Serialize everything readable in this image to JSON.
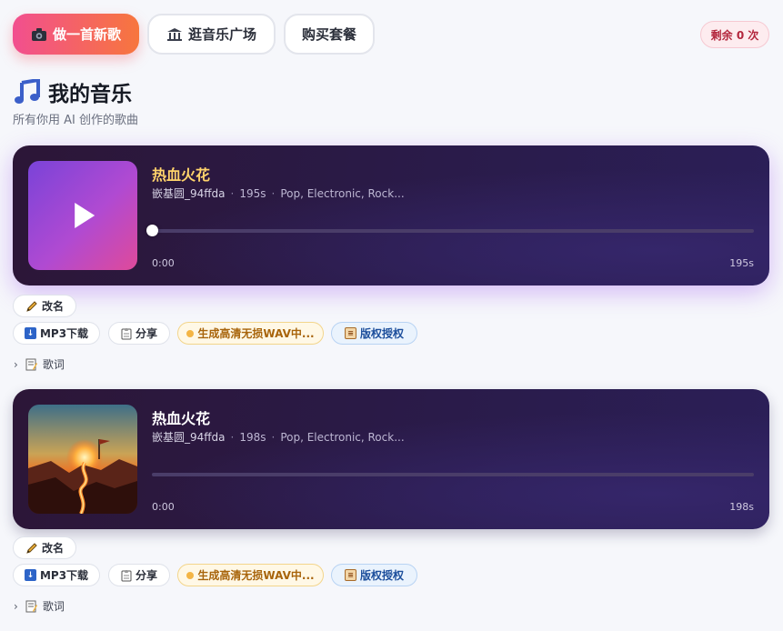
{
  "topbar": {
    "make_song": "做一首新歌",
    "plaza": "逛音乐广场",
    "buy": "购买套餐",
    "remaining": "剩余 0 次"
  },
  "header": {
    "title": "我的音乐",
    "subtitle": "所有你用 AI 创作的歌曲"
  },
  "songs": [
    {
      "title": "热血火花",
      "author": "嵌基圆_94ffda",
      "duration": "195s",
      "genres": "Pop, Electronic, Rock...",
      "time_start": "0:00",
      "time_end": "195s",
      "progress": 0,
      "title_color": "#ffd36b"
    },
    {
      "title": "热血火花",
      "author": "嵌基圆_94ffda",
      "duration": "198s",
      "genres": "Pop, Electronic, Rock...",
      "time_start": "0:00",
      "time_end": "198s",
      "progress": 0,
      "title_color": "#ffffff"
    }
  ],
  "actions": {
    "rename": "改名",
    "mp3": "MP3下载",
    "share": "分享",
    "wav": "生成高清无损WAV中...",
    "license": "版权授权",
    "lyrics": "歌词"
  },
  "icons": {
    "make": "camera-icon",
    "plaza": "bank-icon",
    "title": "music-note-icon",
    "rename": "pencil-icon",
    "mp3": "download-icon",
    "share": "clipboard-icon",
    "license": "scroll-icon",
    "lyrics": "memo-icon"
  }
}
